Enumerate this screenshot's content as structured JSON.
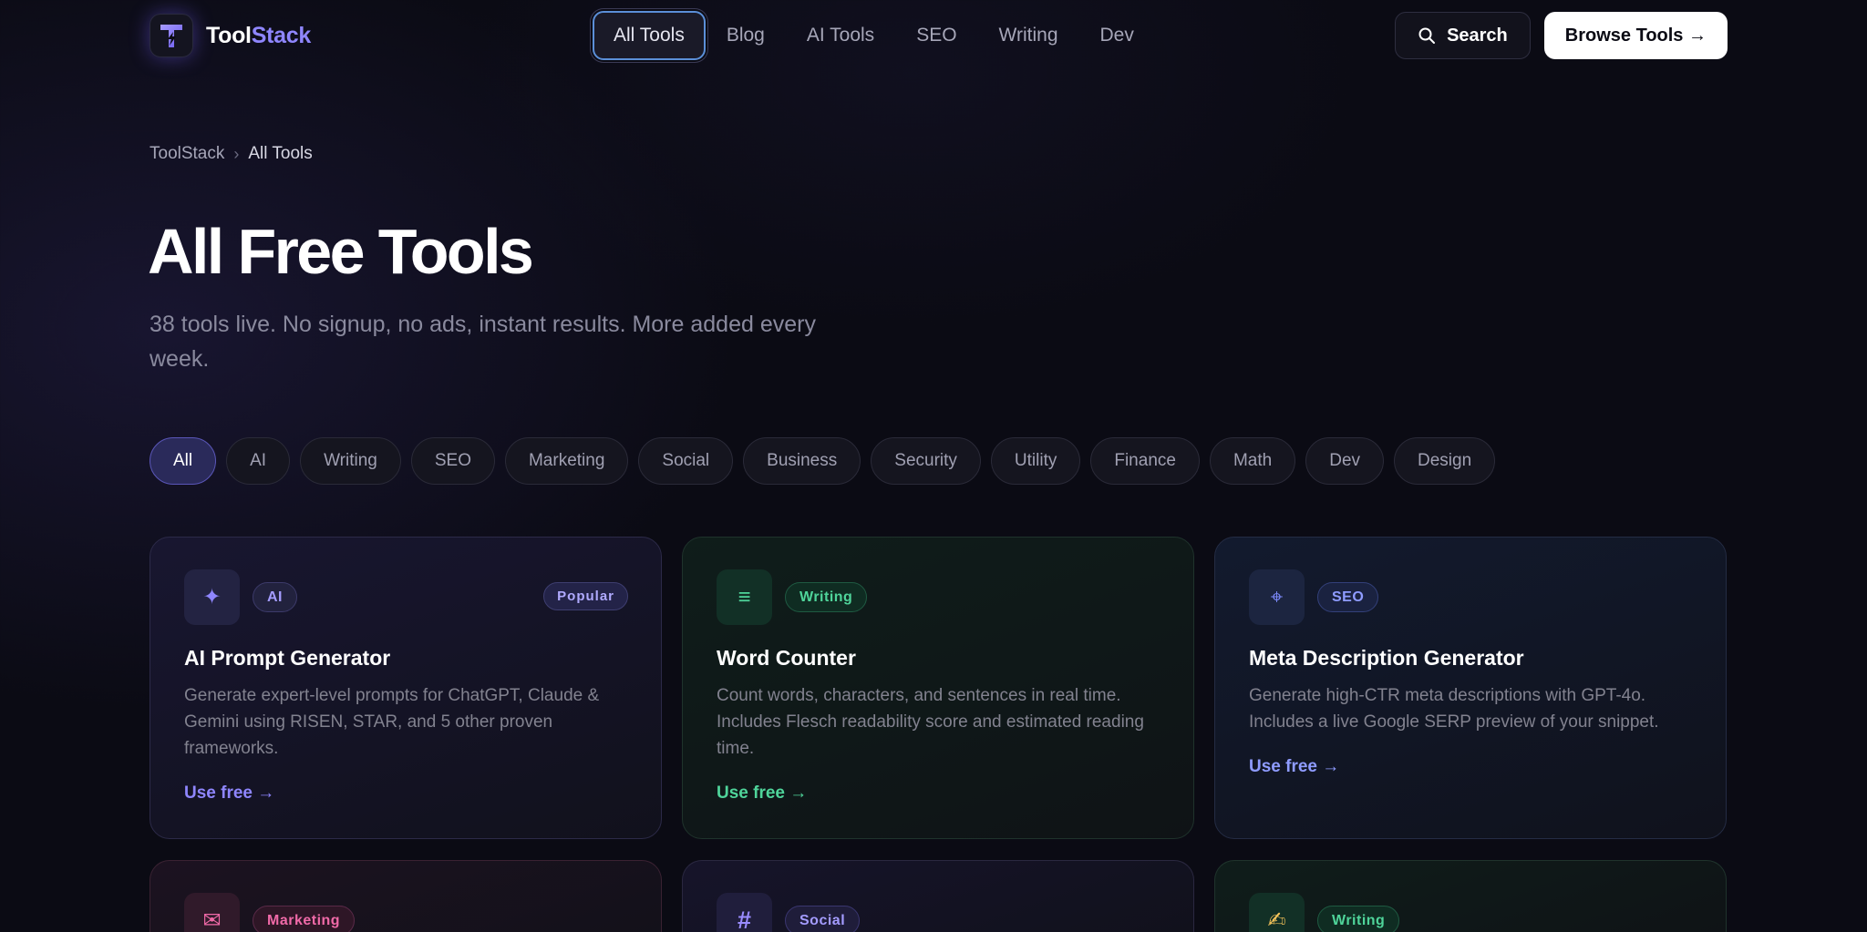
{
  "nav": {
    "logo": {
      "part1": "Tool",
      "part2": "Stack"
    },
    "links": [
      "All Tools",
      "Blog",
      "AI Tools",
      "SEO",
      "Writing",
      "Dev"
    ],
    "active_index": 0,
    "search_label": "Search",
    "browse_label": "Browse Tools →"
  },
  "breadcrumb": {
    "root": "ToolStack",
    "separator": "›",
    "current": "All Tools"
  },
  "hero": {
    "title": "All Free Tools",
    "subtitle": "38 tools live. No signup, no ads, instant results. More added every week."
  },
  "filters": {
    "items": [
      "All",
      "AI",
      "Writing",
      "SEO",
      "Marketing",
      "Social",
      "Business",
      "Security",
      "Utility",
      "Finance",
      "Math",
      "Dev",
      "Design"
    ],
    "active_index": 0
  },
  "cards": [
    {
      "tag": "AI",
      "badge": "Popular",
      "title": "AI Prompt Generator",
      "desc": "Generate expert-level prompts for ChatGPT, Claude & Gemini using RISEN, STAR, and 5 other proven frameworks.",
      "cta": "Use free →",
      "icon": "sparkle-icon",
      "glyph": "✦",
      "accent": "#8f86ff"
    },
    {
      "tag": "Writing",
      "badge": "",
      "title": "Word Counter",
      "desc": "Count words, characters, and sentences in real time. Includes Flesch readability score and estimated reading time.",
      "cta": "Use free →",
      "icon": "lines-icon",
      "glyph": "≡",
      "accent": "#4fd49a"
    },
    {
      "tag": "SEO",
      "badge": "",
      "title": "Meta Description Generator",
      "desc": "Generate high-CTR meta descriptions with GPT-4o. Includes a live Google SERP preview of your snippet.",
      "cta": "Use free →",
      "icon": "crosshair-icon",
      "glyph": "⌖",
      "accent": "#7f8cff"
    },
    {
      "tag": "Marketing",
      "badge": "",
      "icon": "envelope-icon",
      "glyph": "✉",
      "accent": "#f06aa8"
    },
    {
      "tag": "Social",
      "badge": "",
      "icon": "hashtag-icon",
      "glyph": "#",
      "accent": "#9a8cff"
    },
    {
      "tag": "Writing",
      "badge": "",
      "icon": "writing-hand-icon",
      "glyph": "✍",
      "accent": "#4fd49a"
    }
  ]
}
